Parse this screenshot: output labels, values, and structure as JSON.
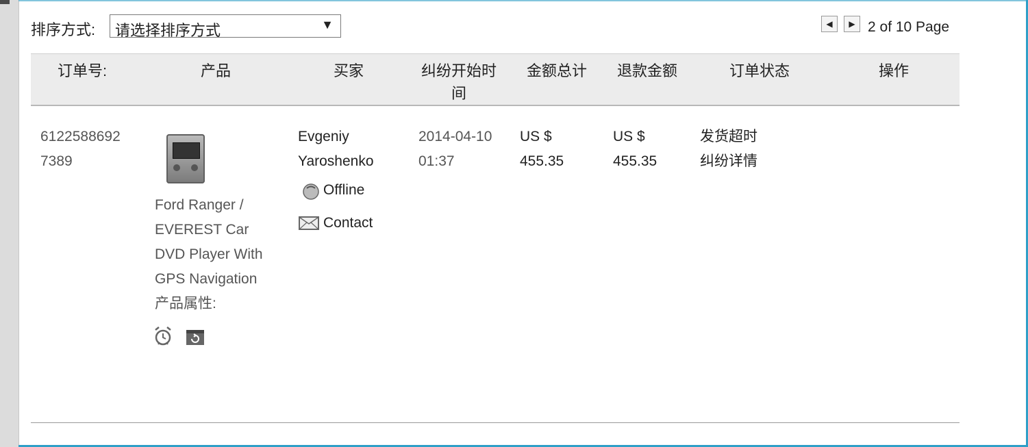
{
  "sort": {
    "label": "排序方式:",
    "selected": "请选择排序方式"
  },
  "pagination": {
    "text": "2 of 10 Page"
  },
  "table": {
    "headers": [
      "订单号:",
      "产品",
      "买家",
      "纠纷开始时间",
      "金额总计",
      "退款金额",
      "订单状态",
      "操作"
    ],
    "header_lines": {
      "start_time_line1": "纠纷开始时",
      "start_time_line2": "间"
    },
    "row": {
      "order_line1": "6122588692",
      "order_line2": "7389",
      "product_lines": [
        "Ford Ranger /",
        "EVEREST Car",
        "DVD Player With",
        "GPS Navigation"
      ],
      "product_attr": "产品属性:",
      "buyer_line1": "Evgeniy",
      "buyer_line2": "Yaroshenko",
      "buyer_status": "Offline",
      "contact": "Contact",
      "date": "2014-04-10",
      "time": "01:37",
      "total_currency": "US $",
      "total_amount": "455.35",
      "refund_currency": "US $",
      "refund_amount": "455.35",
      "status": "发货超时",
      "status_link": "纠纷详情"
    }
  },
  "icons": {
    "dropdown": "chevron-down-icon",
    "prev": "prev-page-icon",
    "next": "next-page-icon",
    "offline": "chat-offline-icon",
    "mail": "mail-icon",
    "alarm": "alarm-clock-icon",
    "calendar": "calendar-refresh-icon"
  }
}
